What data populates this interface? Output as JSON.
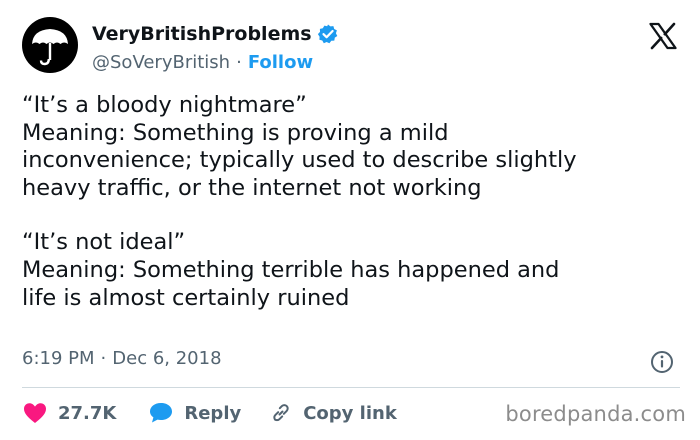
{
  "account": {
    "display_name": "VeryBritishProblems",
    "handle": "@SoVeryBritish",
    "separator": "·",
    "follow_label": "Follow",
    "verified": true
  },
  "tweet": {
    "paragraphs": [
      {
        "lines": [
          "“It’s a bloody nightmare”",
          "Meaning: Something is proving a mild",
          "inconvenience; typically used to describe slightly",
          "heavy traffic, or the internet not working"
        ]
      },
      {
        "lines": [
          "“It’s not ideal”",
          "Meaning: Something terrible has happened and",
          "life is almost certainly ruined"
        ]
      }
    ],
    "time": "6:19 PM",
    "dot": "·",
    "date": "Dec 6, 2018"
  },
  "actions": {
    "likes": "27.7K",
    "reply_label": "Reply",
    "copy_link_label": "Copy link"
  },
  "watermark": "boredpanda.com",
  "colors": {
    "accent": "#1d9bf0",
    "like": "#f91880",
    "text": "#0f1419",
    "muted": "#536471"
  },
  "icons": {
    "avatar": "umbrella-icon",
    "verified": "verified-badge-icon",
    "brand": "x-logo-icon",
    "info": "info-icon",
    "like": "heart-icon",
    "reply": "speech-bubble-icon",
    "copy": "link-icon"
  }
}
